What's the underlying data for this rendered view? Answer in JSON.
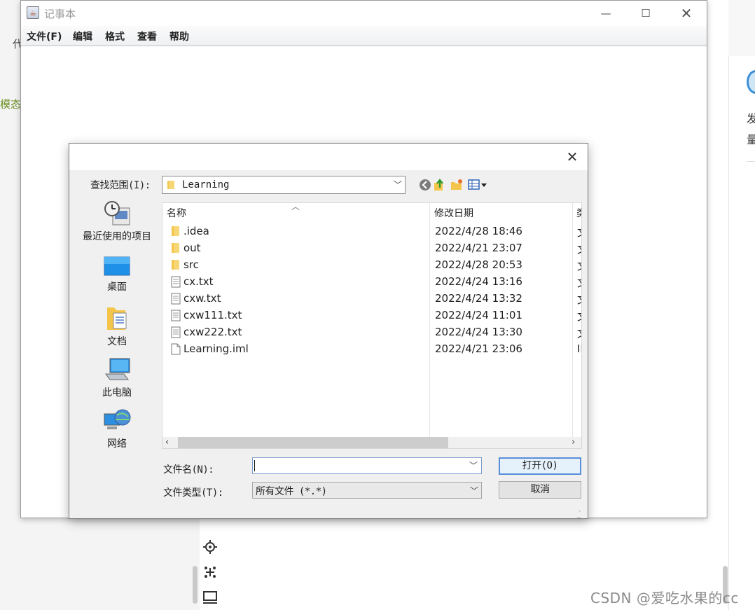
{
  "background": {
    "fragments": [
      "代",
      "模态",
      "发",
      "量"
    ],
    "watermark": "CSDN @爱吃水果的cc"
  },
  "notepad": {
    "title": "记事本",
    "controls": {
      "minimize": "—",
      "maximize": "☐",
      "close": "✕"
    },
    "menu": [
      "文件(F)",
      "编辑",
      "格式",
      "查看",
      "帮助"
    ]
  },
  "dialog": {
    "close": "✕",
    "look_in_label": "查找范围(I):",
    "look_in_value": "Learning",
    "places": [
      {
        "label": "最近使用的项目",
        "icon": "recent-items-icon"
      },
      {
        "label": "桌面",
        "icon": "desktop-icon"
      },
      {
        "label": "文档",
        "icon": "documents-icon"
      },
      {
        "label": "此电脑",
        "icon": "computer-icon"
      },
      {
        "label": "网络",
        "icon": "network-icon"
      }
    ],
    "columns": {
      "name": "名称",
      "date": "修改日期",
      "type": "类"
    },
    "files": [
      {
        "name": ".idea",
        "date": "2022/4/28 18:46",
        "type": "文",
        "kind": "folder"
      },
      {
        "name": "out",
        "date": "2022/4/21 23:07",
        "type": "文",
        "kind": "folder"
      },
      {
        "name": "src",
        "date": "2022/4/28 20:53",
        "type": "文",
        "kind": "folder"
      },
      {
        "name": "cx.txt",
        "date": "2022/4/24 13:16",
        "type": "文",
        "kind": "text"
      },
      {
        "name": "cxw.txt",
        "date": "2022/4/24 13:32",
        "type": "文",
        "kind": "text"
      },
      {
        "name": "cxw111.txt",
        "date": "2022/4/24 11:01",
        "type": "文",
        "kind": "text"
      },
      {
        "name": "cxw222.txt",
        "date": "2022/4/24 13:30",
        "type": "文",
        "kind": "text"
      },
      {
        "name": "Learning.iml",
        "date": "2022/4/21 23:06",
        "type": "IM",
        "kind": "file"
      }
    ],
    "file_name_label": "文件名(N):",
    "file_name_value": "",
    "file_type_label": "文件类型(T):",
    "file_type_value": "所有文件 (*.*)",
    "open_label": "打开(O)",
    "cancel_label": "取消"
  },
  "colors": {
    "folder": "#f3c54b",
    "accent_border": "#5a8ed8",
    "green_text": "#6b8e23"
  }
}
